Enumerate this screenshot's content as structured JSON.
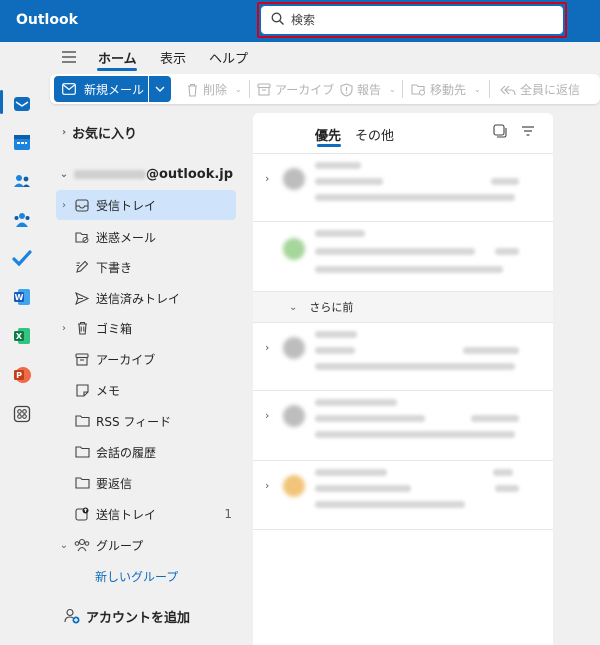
{
  "app": {
    "title": "Outlook"
  },
  "search": {
    "placeholder": "検索"
  },
  "ribbon": {
    "tabs": [
      {
        "label": "ホーム",
        "active": true
      },
      {
        "label": "表示",
        "active": false
      },
      {
        "label": "ヘルプ",
        "active": false
      }
    ]
  },
  "toolbar": {
    "new_mail": "新規メール",
    "delete": "削除",
    "archive": "アーカイブ",
    "report": "報告",
    "move": "移動先",
    "reply_all": "全員に返信"
  },
  "folders": {
    "favorites": "お気に入り",
    "account": "@outlook.jp",
    "items": [
      {
        "label": "受信トレイ",
        "icon": "inbox-icon",
        "selected": true,
        "expandable": true
      },
      {
        "label": "迷惑メール",
        "icon": "junk-icon"
      },
      {
        "label": "下書き",
        "icon": "draft-icon"
      },
      {
        "label": "送信済みトレイ",
        "icon": "sent-icon"
      },
      {
        "label": "ゴミ箱",
        "icon": "trash-icon",
        "expandable": true
      },
      {
        "label": "アーカイブ",
        "icon": "archive-icon"
      },
      {
        "label": "メモ",
        "icon": "note-icon"
      },
      {
        "label": "RSS フィード",
        "icon": "folder-icon"
      },
      {
        "label": "会話の履歴",
        "icon": "folder-icon"
      },
      {
        "label": "要返信",
        "icon": "folder-icon"
      },
      {
        "label": "送信トレイ",
        "icon": "outbox-icon",
        "count": "1"
      }
    ],
    "groups": "グループ",
    "new_group": "新しいグループ",
    "add_account": "アカウントを追加"
  },
  "messages": {
    "tab_focused": "優先",
    "tab_other": "その他",
    "section_earlier": "さらに前"
  },
  "colors": {
    "brand": "#0f6cbd",
    "search_highlight": "#d0021b",
    "selected_folder": "#cfe4fa"
  }
}
